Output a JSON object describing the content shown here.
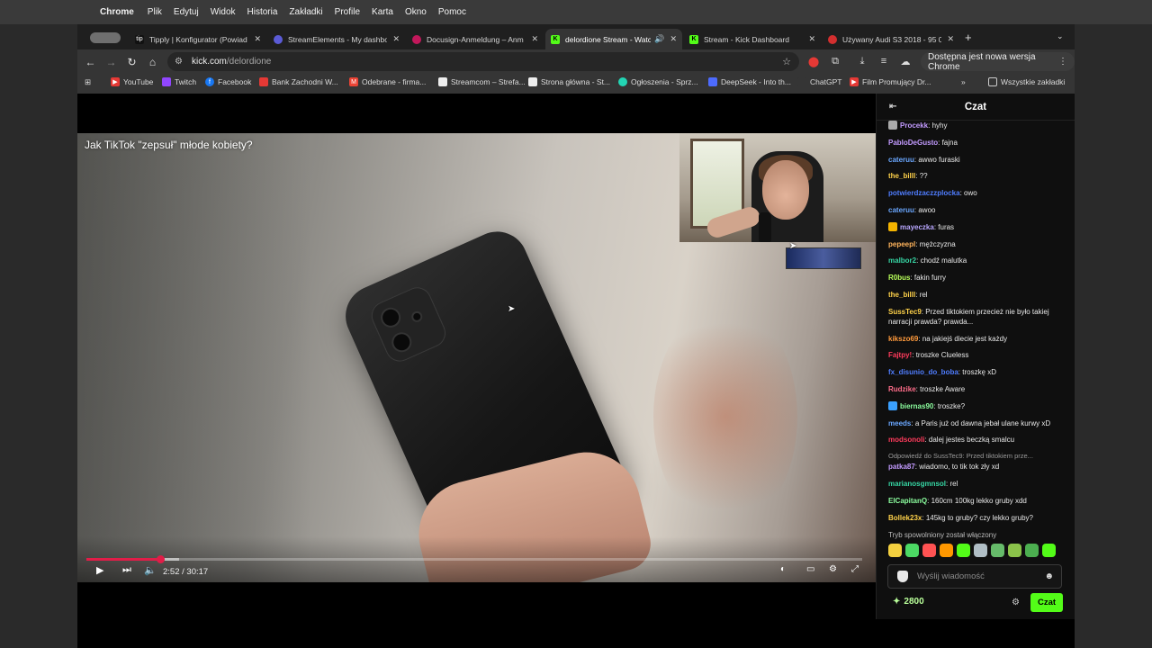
{
  "menubar": {
    "app": "Chrome",
    "items": [
      "Plik",
      "Edytuj",
      "Widok",
      "Historia",
      "Zakładki",
      "Profile",
      "Karta",
      "Okno",
      "Pomoc"
    ]
  },
  "tabs": [
    {
      "title": "Tipply | Konfigurator (Powiad",
      "color": "#1d1d1d"
    },
    {
      "title": "StreamElements - My dashbo",
      "color": "#5b5bd6"
    },
    {
      "title": "Docusign-Anmeldung – Anm",
      "color": "#c2185b"
    },
    {
      "title": "delordione Stream - Watc",
      "color": "#53fc18"
    },
    {
      "title": "Stream - Kick Dashboard",
      "color": "#53fc18"
    },
    {
      "title": "Używany Audi S3 2018 - 95 0",
      "color": "#d32f2f"
    }
  ],
  "toolbar": {
    "url_host": "kick.com",
    "url_path": "/delordione",
    "update_label": "Wersja dostępna jest nowa wersja Chrome"
  },
  "bookmarks": [
    {
      "label": "YouTube",
      "color": "#e53935"
    },
    {
      "label": "Twitch",
      "color": "#9146ff"
    },
    {
      "label": "Facebook",
      "color": "#1877f2"
    },
    {
      "label": "Bank Zachodni W...",
      "color": "#e53935"
    },
    {
      "label": "Odebrane - firma...",
      "color": "#ea4335"
    },
    {
      "label": "Streamcom – Strefa...",
      "color": "#eeeeee"
    },
    {
      "label": "Strona główna - St...",
      "color": "#eeeeee"
    },
    {
      "label": "Ogłoszenia - Sprz...",
      "color": "#23d5b4"
    },
    {
      "label": "DeepSeek - Into th...",
      "color": "#4d6bfe"
    },
    {
      "label": "ChatGPT",
      "color": "#353535"
    },
    {
      "label": "Film Promujący Dr...",
      "color": "#e53935"
    }
  ],
  "bookmarks_more": "»",
  "bookmarks_all": "Wszystkie zakładki",
  "video": {
    "title": "Jak TikTok \"zepsuł\" młode kobiety?",
    "time": "2:52 / 30:17",
    "progress": 0.095,
    "buffered": 0.12
  },
  "chat": {
    "header": "Czat",
    "messages": [
      {
        "user": "Procekk",
        "color": "#c39bff",
        "text": "hyhy",
        "badge": "#aaaaaa"
      },
      {
        "user": "PabloDeGusto",
        "color": "#c39bff",
        "text": "fajna"
      },
      {
        "user": "cateruu",
        "color": "#6aa7ff",
        "text": "awwo furaski"
      },
      {
        "user": "the_billl",
        "color": "#ffd24a",
        "text": "??"
      },
      {
        "user": "potwierdzaczzplocka",
        "color": "#4f7dff",
        "text": "owo"
      },
      {
        "user": "cateruu",
        "color": "#6aa7ff",
        "text": "awoo"
      },
      {
        "user": "mayeczka",
        "color": "#b9a7ff",
        "text": "furas",
        "badge": "#f4b400"
      },
      {
        "user": "pepeepl",
        "color": "#ffb45c",
        "text": "mężczyzna"
      },
      {
        "user": "malbor2",
        "color": "#36d6a4",
        "text": "chodź malutka"
      },
      {
        "user": "R0bus",
        "color": "#b8ff5a",
        "text": "fakin furry"
      },
      {
        "user": "the_billl",
        "color": "#ffd24a",
        "text": "rel"
      },
      {
        "user": "SussTec9",
        "color": "#ffd24a",
        "text": "Przed tiktokiem przecież nie było takiej narracji prawda? prawda..."
      },
      {
        "user": "kikszo69",
        "color": "#ff9a3c",
        "text": "na jakiejś diecie jest każdy"
      },
      {
        "user": "Fajtpy!",
        "color": "#ff3b5c",
        "text": "troszke Clueless"
      },
      {
        "user": "fx_disunio_do_boba",
        "color": "#4f7dff",
        "text": "troszkę xD"
      },
      {
        "user": "Rudzike",
        "color": "#ff6d8a",
        "text": "troszke Aware"
      },
      {
        "user": "biernas90",
        "color": "#8cff9f",
        "text": "troszke?",
        "badge": "#3aa0ff"
      },
      {
        "user": "meeds",
        "color": "#6aa7ff",
        "text": "a Paris już od dawna jebał ulane kurwy xD"
      },
      {
        "user": "modsonoli",
        "color": "#ff3b5c",
        "text": "dalej jestes beczką smalcu"
      },
      {
        "user": "patka87",
        "color": "#c39bff",
        "text": "wiadomo, to tik tok zły xd",
        "reply": "Odpowiedź do SussTec9: Przed tiktokiem prze..."
      },
      {
        "user": "marianosgmnsol",
        "color": "#36d6a4",
        "text": "rel"
      },
      {
        "user": "ElCapitanQ",
        "color": "#8cff9f",
        "text": "160cm 100kg lekko gruby xdd"
      },
      {
        "user": "Bollek23x",
        "color": "#ffd24a",
        "text": "145kg to gruby? czy lekko gruby?"
      }
    ],
    "slowmode": "Tryb spowolniony został włączony",
    "input_placeholder": "Wyślij wiadomość",
    "points": "2800",
    "send_label": "Czat"
  },
  "emote_colors": [
    "#f4d03f",
    "#4cd964",
    "#ff5252",
    "#ff9800",
    "#53fc18",
    "#b0bec5",
    "#66bb6a",
    "#8bc34a",
    "#4caf50",
    "#53fc18"
  ]
}
